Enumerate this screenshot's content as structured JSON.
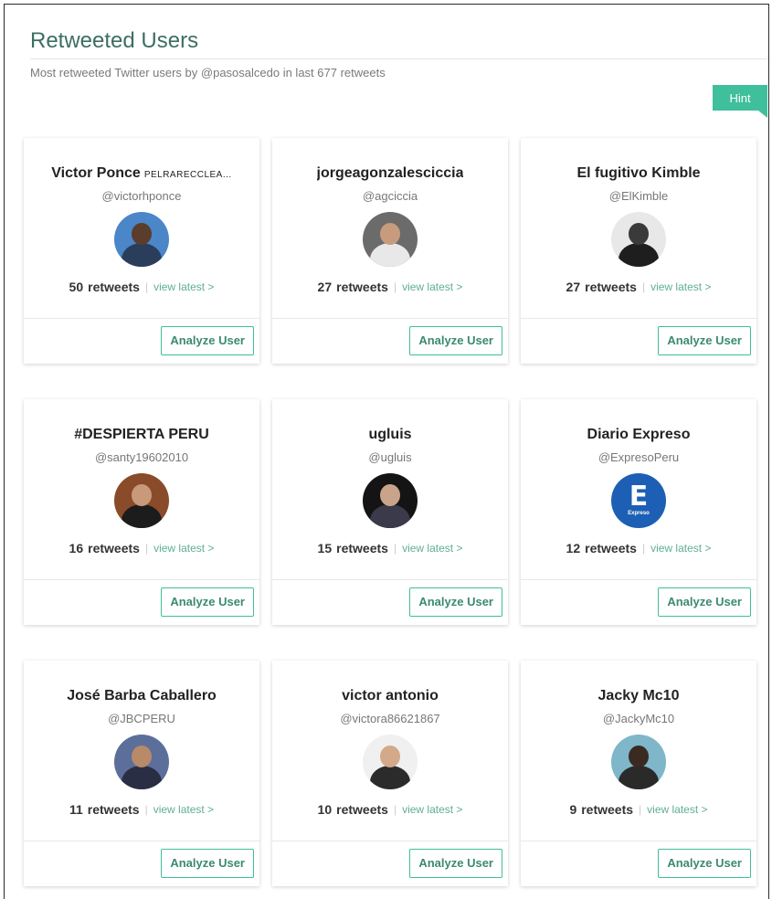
{
  "header": {
    "title": "Retweeted Users",
    "subtitle": "Most retweeted Twitter users by @pasosalcedo in last 677 retweets",
    "hint_label": "Hint"
  },
  "labels": {
    "retweets_suffix": "retweets",
    "separator": "|",
    "view_latest": "view latest >",
    "analyze_button": "Analyze User"
  },
  "users": [
    {
      "name": "Victor Ponce",
      "name_tag": "PELRARECCLEA...",
      "handle": "@victorhponce",
      "retweets": "50",
      "avatar": {
        "bg": "#4a86c8",
        "head": "#5a3d2b",
        "body": "#2a3e5c"
      }
    },
    {
      "name": "jorgeagonzalesciccia",
      "name_tag": "",
      "handle": "@agciccia",
      "retweets": "27",
      "avatar": {
        "bg": "#6b6b6b",
        "head": "#c79b7c",
        "body": "#e8e8e8"
      }
    },
    {
      "name": "El fugitivo Kimble",
      "name_tag": "",
      "handle": "@ElKimble",
      "retweets": "27",
      "avatar": {
        "bg": "#e8e8e8",
        "head": "#3a3a3a",
        "body": "#1e1e1e"
      }
    },
    {
      "name": "#DESPIERTA PERU",
      "name_tag": "",
      "handle": "@santy19602010",
      "retweets": "16",
      "avatar": {
        "bg": "#8a4b2a",
        "head": "#c89a7a",
        "body": "#1c1c1c"
      }
    },
    {
      "name": "ugluis",
      "name_tag": "",
      "handle": "@ugluis",
      "retweets": "15",
      "avatar": {
        "bg": "#141414",
        "head": "#c9a48a",
        "body": "#3a3a4a"
      }
    },
    {
      "name": "Diario Expreso",
      "name_tag": "",
      "handle": "@ExpresoPeru",
      "retweets": "12",
      "avatar": {
        "bg": "#1d5fb4",
        "head": "#1d5fb4",
        "body": "#1d5fb4"
      },
      "logo_letter": "E",
      "logo_word": "Expreso"
    },
    {
      "name": "José Barba Caballero",
      "name_tag": "",
      "handle": "@JBCPERU",
      "retweets": "11",
      "avatar": {
        "bg": "#5b6f9a",
        "head": "#b88a6a",
        "body": "#2a2e44"
      }
    },
    {
      "name": "victor antonio",
      "name_tag": "",
      "handle": "@victora86621867",
      "retweets": "10",
      "avatar": {
        "bg": "#f0f0f0",
        "head": "#d3a98a",
        "body": "#2b2b2b"
      }
    },
    {
      "name": "Jacky Mc10",
      "name_tag": "",
      "handle": "@JackyMc10",
      "retweets": "9",
      "avatar": {
        "bg": "#7fb6c9",
        "head": "#3a2a22",
        "body": "#2a2a2a"
      }
    }
  ]
}
